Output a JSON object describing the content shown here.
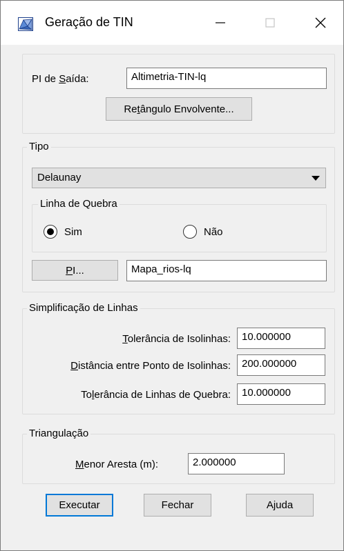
{
  "window": {
    "title": "Geração de TIN",
    "minimize_glyph": "—",
    "maximize_glyph": "☐",
    "close_glyph": "✕"
  },
  "output": {
    "label_prefix": "PI de ",
    "label_accel": "S",
    "label_suffix": "aída:",
    "value": "Altimetria-TIN-lq",
    "bbox_button_pre": "Re",
    "bbox_button_accel": "t",
    "bbox_button_post": "ângulo Envolvente..."
  },
  "tipo": {
    "group_title": "Tipo",
    "selected": "Delaunay",
    "breakline": {
      "group_title": "Linha de Quebra",
      "option_yes": "Sim",
      "option_no": "Não",
      "selected": "Sim"
    },
    "pi_button_accel": "P",
    "pi_button_rest": "I...",
    "pi_value": "Mapa_rios-lq"
  },
  "simplification": {
    "group_title": "Simplificação de Linhas",
    "rows": [
      {
        "accel": "T",
        "rest": "olerância de Isolinhas:",
        "pre": "",
        "value": "10.000000"
      },
      {
        "accel": "D",
        "rest": "istância entre Ponto de Isolinhas:",
        "pre": "",
        "value": "200.000000"
      },
      {
        "pre": "To",
        "accel": "l",
        "rest": "erância de Linhas de Quebra:",
        "value": "10.000000"
      }
    ]
  },
  "triangulation": {
    "group_title": "Triangulação",
    "label_accel": "M",
    "label_rest": "enor Aresta (m):",
    "value": "2.000000"
  },
  "buttons": {
    "execute": "Executar",
    "close": "Fechar",
    "help": "Ajuda"
  },
  "colors": {
    "accent": "#0078d7",
    "window_bg": "#f0f0f0",
    "button_bg": "#e1e1e1"
  }
}
